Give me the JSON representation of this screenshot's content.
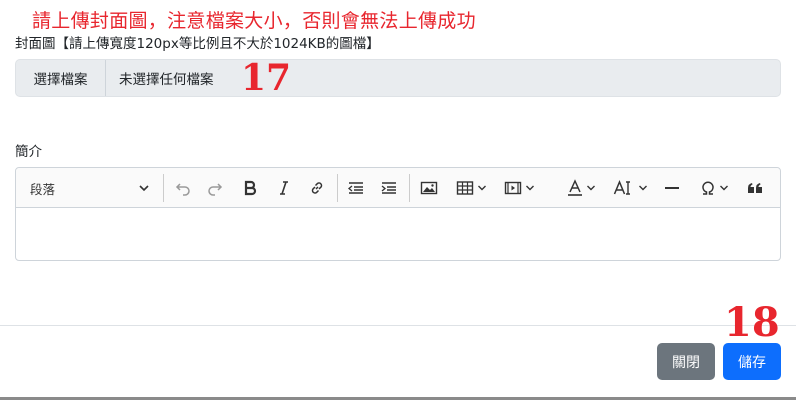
{
  "warning_text": "請上傳封面圖，注意檔案大小，否則會無法上傳成功",
  "cover": {
    "label": "封面圖【請上傳寬度120px等比例且不大於1024KB的圖檔】",
    "file_button_label": "選擇檔案",
    "file_status": "未選擇任何檔案"
  },
  "intro": {
    "label": "簡介",
    "heading_select_value": "段落",
    "toolbar_icons": [
      "undo-icon",
      "redo-icon",
      "bold-icon",
      "italic-icon",
      "link-icon",
      "outdent-icon",
      "indent-icon",
      "image-icon",
      "table-icon",
      "media-icon",
      "font-color-icon",
      "text-case-icon",
      "horizontal-line-icon",
      "special-characters-icon",
      "blockquote-icon"
    ]
  },
  "annotations": {
    "a17": "17",
    "a18": "18"
  },
  "footer": {
    "close_label": "關閉",
    "save_label": "儲存"
  },
  "colors": {
    "warning": "#e8262e",
    "primary": "#0d6efd",
    "secondary": "#6c757d"
  }
}
